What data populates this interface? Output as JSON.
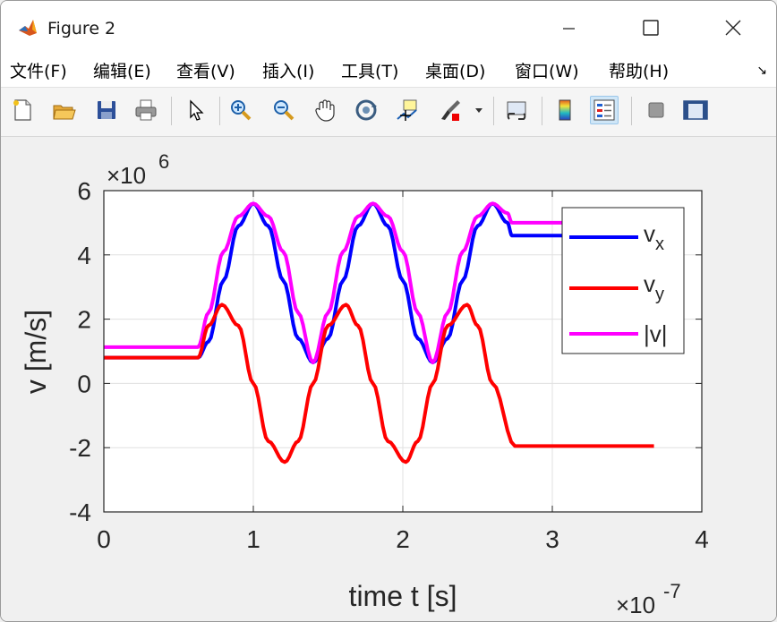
{
  "window": {
    "title": "Figure 2"
  },
  "menu": [
    "文件(F)",
    "编辑(E)",
    "查看(V)",
    "插入(I)",
    "工具(T)",
    "桌面(D)",
    "窗口(W)",
    "帮助(H)"
  ],
  "toolbar": [
    "new-figure-icon",
    "open-file-icon",
    "save-icon",
    "print-icon",
    "select-pointer-icon",
    "zoom-in-icon",
    "zoom-out-icon",
    "pan-hand-icon",
    "rotate-3d-icon",
    "data-cursor-icon",
    "brush-icon",
    "brush-dropdown-icon",
    "link-plot-icon",
    "colorbar-icon",
    "legend-icon",
    "hide-plot-tools-icon",
    "show-plot-tools-icon"
  ],
  "axes": {
    "xlabel": "time  t  [s]",
    "ylabel": "v  [m/s]",
    "x_exponent_base": "×10",
    "x_exponent_power": "-7",
    "y_exponent_base": "×10",
    "y_exponent_power": "6",
    "xticks": [
      "0",
      "1",
      "2",
      "3",
      "4"
    ],
    "yticks": [
      "-4",
      "-2",
      "0",
      "2",
      "4",
      "6"
    ]
  },
  "legend": [
    {
      "label": "v",
      "sub": "x",
      "color": "#0000ff"
    },
    {
      "label": "v",
      "sub": "y",
      "color": "#ff0000"
    },
    {
      "label": "|v|",
      "sub": "",
      "color": "#ff00ff"
    }
  ],
  "chart_data": {
    "type": "line",
    "xlim": [
      0,
      4
    ],
    "ylim": [
      -4,
      6
    ],
    "x_scale_exponent": -7,
    "y_scale_exponent": 6,
    "grid": true,
    "legend_position": "top-right",
    "xlabel": "time  t  [s]",
    "ylabel": "v  [m/s]",
    "series": [
      {
        "name": "vx",
        "color": "#0000ff",
        "x": [
          0,
          0.63,
          0.7,
          0.8,
          0.9,
          1.0,
          1.1,
          1.2,
          1.3,
          1.4,
          1.5,
          1.6,
          1.7,
          1.8,
          1.9,
          2.0,
          2.1,
          2.2,
          2.3,
          2.4,
          2.5,
          2.6,
          2.7,
          2.73,
          3.0,
          3.5,
          3.68
        ],
        "y": [
          0.8,
          0.8,
          1.3,
          3.2,
          4.9,
          5.6,
          4.9,
          3.2,
          1.4,
          0.65,
          1.4,
          3.2,
          4.9,
          5.6,
          4.9,
          3.2,
          1.4,
          0.65,
          1.4,
          3.2,
          4.9,
          5.6,
          5.0,
          4.6,
          4.6,
          4.6,
          4.6
        ]
      },
      {
        "name": "vy",
        "color": "#ff0000",
        "x": [
          0,
          0.63,
          0.7,
          0.79,
          0.9,
          1.0,
          1.1,
          1.21,
          1.3,
          1.4,
          1.5,
          1.62,
          1.7,
          1.8,
          1.9,
          2.02,
          2.1,
          2.2,
          2.3,
          2.43,
          2.5,
          2.6,
          2.75,
          3.0,
          3.5,
          3.68
        ],
        "y": [
          0.8,
          0.8,
          1.8,
          2.45,
          1.8,
          0.0,
          -1.8,
          -2.45,
          -1.8,
          0.0,
          1.8,
          2.45,
          1.8,
          0.0,
          -1.8,
          -2.45,
          -1.8,
          0.0,
          1.8,
          2.45,
          1.8,
          0.0,
          -1.95,
          -1.95,
          -1.95,
          -1.95
        ]
      },
      {
        "name": "|v|",
        "color": "#ff00ff",
        "x": [
          0,
          0.63,
          0.7,
          0.8,
          0.9,
          1.0,
          1.1,
          1.2,
          1.3,
          1.4,
          1.5,
          1.6,
          1.7,
          1.8,
          1.9,
          2.0,
          2.1,
          2.2,
          2.3,
          2.4,
          2.5,
          2.6,
          2.7,
          2.73,
          3.0,
          3.5,
          3.68
        ],
        "y": [
          1.13,
          1.13,
          2.2,
          4.1,
          5.2,
          5.6,
          5.2,
          4.1,
          2.2,
          0.65,
          2.2,
          4.1,
          5.2,
          5.6,
          5.2,
          4.1,
          2.2,
          0.65,
          2.2,
          4.1,
          5.2,
          5.6,
          5.3,
          5.0,
          5.0,
          5.0,
          5.0
        ]
      }
    ]
  }
}
